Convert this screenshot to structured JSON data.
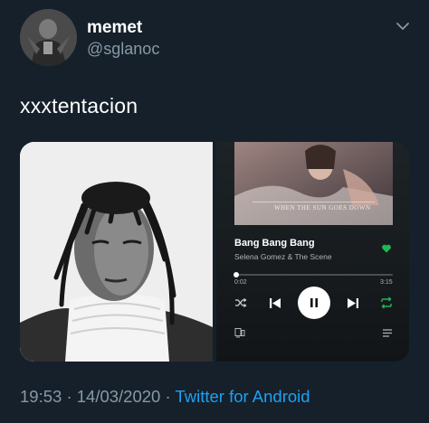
{
  "user": {
    "display_name": "memet",
    "handle": "@sglanoc"
  },
  "tweet": {
    "text": "xxxtentacion",
    "time": "19:53",
    "date": "14/03/2020",
    "source": "Twitter for Android",
    "separator": "·"
  },
  "player": {
    "album_caption": "WHEN THE SUN GOES DOWN",
    "song_title": "Bang Bang Bang",
    "artist": "Selena Gomez & The Scene",
    "elapsed": "0:02",
    "total": "3:15",
    "progress": 0.01,
    "liked": true
  },
  "colors": {
    "background": "#15202b",
    "secondary_text": "#8899a6",
    "link": "#1da1f2",
    "spotify_green": "#1db954"
  },
  "icons": {
    "caret": "chevron-down-icon",
    "heart": "heart-icon",
    "shuffle": "shuffle-icon",
    "previous": "skip-previous-icon",
    "play_pause": "pause-icon",
    "next": "skip-next-icon",
    "repeat": "repeat-icon",
    "devices": "devices-icon",
    "queue": "queue-icon"
  }
}
